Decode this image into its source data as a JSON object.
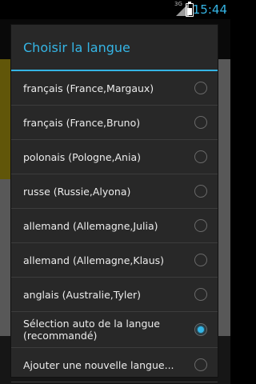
{
  "status_bar": {
    "signal_label": "3G",
    "time": "15:44",
    "icons": [
      "signal-3g-icon",
      "battery-charging-icon"
    ],
    "accent_color": "#35b5e5"
  },
  "dialog": {
    "title": "Choisir la langue",
    "options": [
      {
        "label": "français (France,Margaux)",
        "selected": false
      },
      {
        "label": "français (France,Bruno)",
        "selected": false
      },
      {
        "label": "polonais (Pologne,Ania)",
        "selected": false
      },
      {
        "label": "russe (Russie,Alyona)",
        "selected": false
      },
      {
        "label": "allemand (Allemagne,Julia)",
        "selected": false
      },
      {
        "label": "allemand (Allemagne,Klaus)",
        "selected": false
      },
      {
        "label": "anglais (Australie,Tyler)",
        "selected": false
      },
      {
        "label": "Sélection auto de la langue (recommandé)",
        "selected": true
      },
      {
        "label": "Ajouter une nouvelle langue...",
        "selected": false
      }
    ]
  }
}
